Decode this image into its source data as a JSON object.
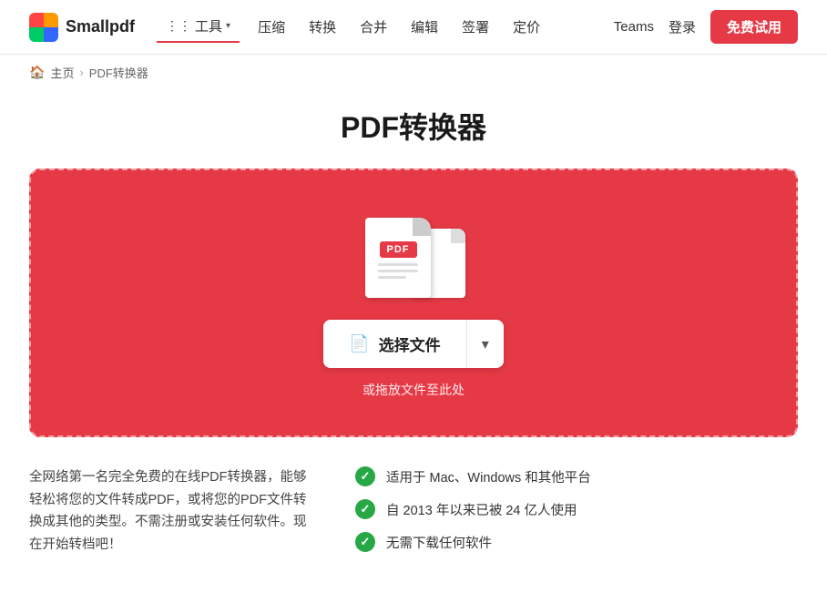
{
  "header": {
    "logo_text": "Smallpdf",
    "tools_label": "工具",
    "nav_items": [
      "压缩",
      "转换",
      "合并",
      "编辑",
      "签署"
    ],
    "pricing_label": "定价",
    "teams_label": "Teams",
    "login_label": "登录",
    "free_trial_label": "免费试用"
  },
  "breadcrumb": {
    "home_label": "主页",
    "current_label": "PDF转换器"
  },
  "page": {
    "title": "PDF转换器"
  },
  "dropzone": {
    "select_file_label": "选择文件",
    "pdf_label": "PDF",
    "drop_text": "或拖放文件至此处"
  },
  "features": {
    "description": "全网络第一名完全免费的在线PDF转换器，能够轻松将您的文件转成PDF，或将您的PDF文件转换成其他的类型。不需注册或安装任何软件。现在开始转档吧！",
    "items": [
      "适用于 Mac、Windows 和其他平台",
      "自 2013 年以来已被 24 亿人使用",
      "无需下载任何软件"
    ]
  }
}
